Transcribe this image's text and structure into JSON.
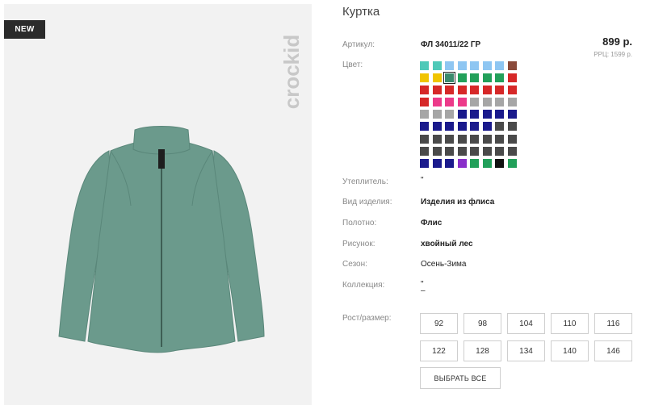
{
  "product": {
    "title": "Куртка",
    "badge": "NEW",
    "brand": "crockid",
    "price": "899 р.",
    "rrp": "РРЦ: 1599 р."
  },
  "specs": {
    "article": {
      "label": "Артикул:",
      "value": "ФЛ 34011/22 ГР"
    },
    "color": {
      "label": "Цвет:"
    },
    "insulation": {
      "label": "Утеплитель:",
      "value": "\""
    },
    "type": {
      "label": "Вид изделия:",
      "value": "Изделия из флиса"
    },
    "fabric": {
      "label": "Полотно:",
      "value": "Флис"
    },
    "pattern": {
      "label": "Рисунок:",
      "value": "хвойный лес"
    },
    "season": {
      "label": "Сезон:",
      "value": "Осень-Зима"
    },
    "collection": {
      "label": "Коллекция:",
      "value": "\"",
      "value2": "–"
    },
    "size": {
      "label": "Рост/размер:"
    }
  },
  "swatch_colors": [
    [
      "#4fc9b8",
      "#4fc9b8",
      "#8ec6f2",
      "#8ec6f2",
      "#8ec6f2",
      "#8ec6f2",
      "#8ec6f2",
      "#8a4a3a"
    ],
    [
      "#f0c400",
      "#f0c400",
      "#3b8a6d",
      "#22a05a",
      "#22a05a",
      "#22a05a",
      "#22a05a",
      "#d62828"
    ],
    [
      "#d62828",
      "#d62828",
      "#d62828",
      "#d62828",
      "#d62828",
      "#d62828",
      "#d62828",
      "#d62828"
    ],
    [
      "#d62828",
      "#ec3a8a",
      "#ec3a8a",
      "#ec3a8a",
      "#a6a6a6",
      "#a6a6a6",
      "#a6a6a6",
      "#a6a6a6"
    ],
    [
      "#a6a6a6",
      "#a6a6a6",
      "#a6a6a6",
      "#1a1a8c",
      "#1a1a8c",
      "#1a1a8c",
      "#1a1a8c",
      "#1a1a8c"
    ],
    [
      "#1a1a8c",
      "#1a1a8c",
      "#1a1a8c",
      "#1a1a8c",
      "#1a1a8c",
      "#1a1a8c",
      "#4a4a4a",
      "#4a4a4a"
    ],
    [
      "#4a4a4a",
      "#4a4a4a",
      "#4a4a4a",
      "#4a4a4a",
      "#4a4a4a",
      "#4a4a4a",
      "#4a4a4a",
      "#4a4a4a"
    ],
    [
      "#4a4a4a",
      "#4a4a4a",
      "#4a4a4a",
      "#4a4a4a",
      "#4a4a4a",
      "#4a4a4a",
      "#4a4a4a",
      "#4a4a4a"
    ],
    [
      "#1a1a8c",
      "#1a1a8c",
      "#1a1a8c",
      "#8a2fc9",
      "#22a05a",
      "#22a05a",
      "#111111",
      "#22a05a"
    ]
  ],
  "selected_swatch": [
    1,
    2
  ],
  "sizes": [
    "92",
    "98",
    "104",
    "110",
    "116",
    "122",
    "128",
    "134",
    "140",
    "146"
  ],
  "select_all_label": "ВЫБРАТЬ ВСЕ",
  "jacket_color": "#6b9a8c"
}
